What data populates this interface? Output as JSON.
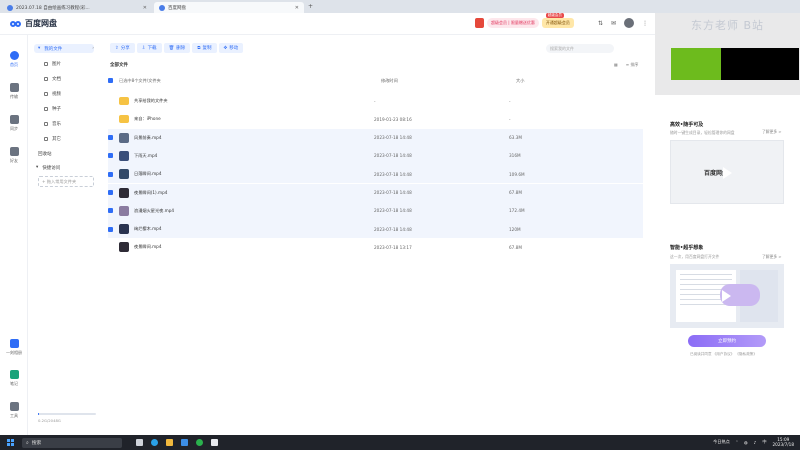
{
  "window": {
    "tabs": [
      {
        "label": "2023.07.18 自由绘画练习教程(彩..."
      },
      {
        "label": "百度网盘"
      }
    ],
    "controls": {
      "minimize": "—",
      "maximize": "☐",
      "close": "✕"
    }
  },
  "header": {
    "app_name": "百度网盘",
    "promo": "超级会员 | 限量赠送优惠",
    "vip_badge_top": "超级会员",
    "vip_label": "开通超级会员"
  },
  "rail": {
    "items": [
      {
        "label": "首页",
        "icon": "cloud-icon"
      },
      {
        "label": "传输",
        "icon": "transfer-icon"
      },
      {
        "label": "同步",
        "icon": "sync-icon"
      },
      {
        "label": "好友",
        "icon": "friends-icon"
      }
    ],
    "bottom": [
      {
        "label": "一刻相册",
        "icon": "album-icon"
      },
      {
        "label": "笔记",
        "icon": "note-icon"
      },
      {
        "label": "工具",
        "icon": "tools-icon"
      }
    ]
  },
  "sidebar": {
    "my_files": "我的文件",
    "items": [
      "图片",
      "文档",
      "视频",
      "种子",
      "音乐",
      "其它"
    ],
    "recycle": "回收站",
    "quick_access": "快捷访问",
    "add_quick": "+ 拖入常用文件夹",
    "storage_text": "0.2G/2048G",
    "storage_fraction": 0.01
  },
  "toolbar": {
    "buttons": [
      {
        "label": "分享",
        "icon": "share-icon"
      },
      {
        "label": "下载",
        "icon": "download-icon"
      },
      {
        "label": "删除",
        "icon": "delete-icon"
      },
      {
        "label": "复制",
        "icon": "copy-icon"
      },
      {
        "label": "移动",
        "icon": "move-icon"
      }
    ],
    "search_placeholder": "搜索我的文件"
  },
  "main": {
    "breadcrumb": "全部文件",
    "view_label": "排序",
    "header": {
      "selected": "已选中8个文件/文件夹",
      "time": "修改时间",
      "size": "大小"
    },
    "files": [
      {
        "name": "共享给我的文件夹",
        "time": "-",
        "size": "-",
        "type": "folder",
        "selected": false
      },
      {
        "name": "来自：iPhone",
        "time": "2019-01-23 08:16",
        "size": "-",
        "type": "folder",
        "selected": false
      },
      {
        "name": "风景前奏.mp4",
        "time": "2023-07-18 14:48",
        "size": "63.3M",
        "type": "video",
        "selected": true,
        "color": "#5b6b86"
      },
      {
        "name": "下雨天.mp4",
        "time": "2023-07-18 14:48",
        "size": "316M",
        "type": "video",
        "selected": true,
        "color": "#3b4f7a"
      },
      {
        "name": "日落瞬间.mp4",
        "time": "2023-07-18 14:48",
        "size": "109.6M",
        "type": "video",
        "selected": true,
        "color": "#334968"
      },
      {
        "name": "夜景瞬间(1).mp4",
        "time": "2023-07-18 14:48",
        "size": "67.8M",
        "type": "video",
        "selected": true,
        "color": "#2e2b36"
      },
      {
        "name": "浪漫烟火星光夜.mp4",
        "time": "2023-07-18 14:48",
        "size": "172.4M",
        "type": "video",
        "selected": true,
        "color": "#8a7ba0"
      },
      {
        "name": "绚烂樱木.mp4",
        "time": "2023-07-18 14:48",
        "size": "120M",
        "type": "video",
        "selected": true,
        "color": "#2a3350"
      },
      {
        "name": "夜景瞬间.mp4",
        "time": "2023-07-18 13:17",
        "size": "67.8M",
        "type": "video",
        "selected": false,
        "color": "#2e2b36"
      }
    ]
  },
  "right_panel": {
    "overlay_text": "东方老师 B站",
    "card1": {
      "title": "高效•随手可及",
      "sub": "随时一键生成目录，轻松管理你的网盘",
      "link": "了解更多 >",
      "video_logo": "百度网盘"
    },
    "card2": {
      "title": "智能•超乎想象",
      "sub": "这一次，用百度网盘打开文件",
      "link": "了解更多 >"
    },
    "cta": "立即预约",
    "legal": "已阅读并同意 《用户协议》 《隐私政策》"
  },
  "taskbar": {
    "search_label": "搜索",
    "news": "今日热点",
    "time": "15:09",
    "date": "2023/7/18",
    "lang": "中"
  },
  "colors": {
    "accent": "#2f6df6",
    "selected_row": "#f1f5fd",
    "cta": "#8b6cf6"
  }
}
